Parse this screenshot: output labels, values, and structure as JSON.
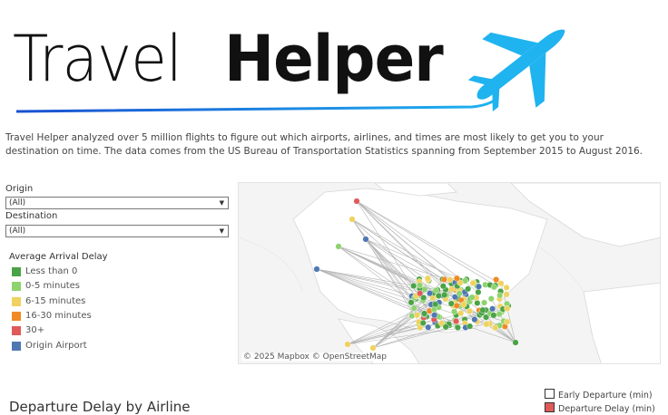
{
  "app": {
    "title_regular": "Travel",
    "title_bold": "Helper",
    "logo_icon": "airplane-icon",
    "accent_color": "#1fb3f0"
  },
  "intro_text": "Travel Helper analyzed over 5 million flights to figure out which airports, airlines, and times are most likely to get you to your destination on time. The data comes from the US Bureau of Transportation Statistics spanning from September 2015 to August 2016.",
  "filters": {
    "origin": {
      "label": "Origin",
      "value": "(All)"
    },
    "destination": {
      "label": "Destination",
      "value": "(All)"
    }
  },
  "legend": {
    "title": "Average Arrival Delay",
    "items": [
      {
        "label": "Less than 0",
        "color": "#4aa346"
      },
      {
        "label": "0-5 minutes",
        "color": "#8ed36e"
      },
      {
        "label": "6-15 minutes",
        "color": "#efd25f"
      },
      {
        "label": "16-30 minutes",
        "color": "#ef8a25"
      },
      {
        "label": "30+",
        "color": "#e05a5a"
      },
      {
        "label": "Origin Airport",
        "color": "#4f78b3"
      }
    ]
  },
  "map": {
    "credit": "© 2025 Mapbox © OpenStreetMap"
  },
  "departure_section": {
    "title": "Departure Delay by Airline",
    "key": [
      {
        "label": "Early Departure (min)",
        "color": "#ffffff"
      },
      {
        "label": "Departure Delay (min)",
        "color": "#e05a5a"
      }
    ]
  }
}
